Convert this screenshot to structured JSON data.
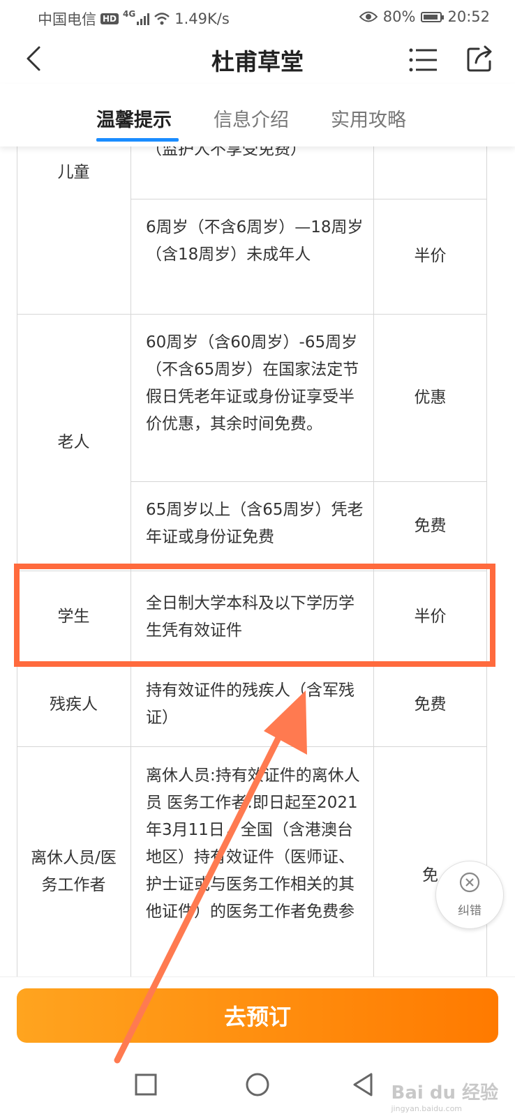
{
  "status_bar": {
    "carrier": "中国电信",
    "hd": "HD",
    "network": "4G",
    "speed": "1.49K/s",
    "battery": "80%",
    "time": "20:52"
  },
  "header": {
    "title": "杜甫草堂"
  },
  "tabs": [
    {
      "label": "温馨提示",
      "active": true
    },
    {
      "label": "信息介绍",
      "active": false
    },
    {
      "label": "实用攻略",
      "active": false
    }
  ],
  "table": {
    "rows": [
      {
        "category": "儿童",
        "items": [
          {
            "description": "由监护人亲东带领入场（监护人不享受免费）",
            "description_visible": "（监护人不享受免费）",
            "price": ""
          },
          {
            "description": "6周岁（不含6周岁）—18周岁（含18周岁）未成年人",
            "price": "半价"
          }
        ]
      },
      {
        "category": "老人",
        "items": [
          {
            "description": "60周岁（含60周岁）-65周岁（不含65周岁）在国家法定节假日凭老年证或身份证享受半价优惠，其余时间免费。",
            "price": "优惠"
          },
          {
            "description": "65周岁以上（含65周岁）凭老年证或身份证免费",
            "price": "免费"
          }
        ]
      },
      {
        "category": "学生",
        "items": [
          {
            "description": "全日制大学本科及以下学历学生凭有效证件",
            "price": "半价"
          }
        ]
      },
      {
        "category": "残疾人",
        "items": [
          {
            "description": "持有效证件的残疾人（含军残证）",
            "price": "免费"
          }
        ]
      },
      {
        "category": "离休人员/医务工作者",
        "items": [
          {
            "description": "离休人员:持有效证件的离休人员 医务工作者:即日起至2021年3月11日，全国（含港澳台地区）持有效证件（医师证、护士证或与医务工作相关的其他证件）的医务工作者免费参",
            "price": "免"
          }
        ]
      }
    ]
  },
  "correction_button": {
    "label": "纠错"
  },
  "book_button": {
    "label": "去预订"
  },
  "watermark": {
    "brand": "Bai du 经验",
    "url": "jingyan.baidu.com"
  },
  "colors": {
    "tab_underline": "#1a8cff",
    "highlight": "#ff6a3d",
    "book_start": "#ffa41f",
    "book_end": "#ff7a00"
  }
}
